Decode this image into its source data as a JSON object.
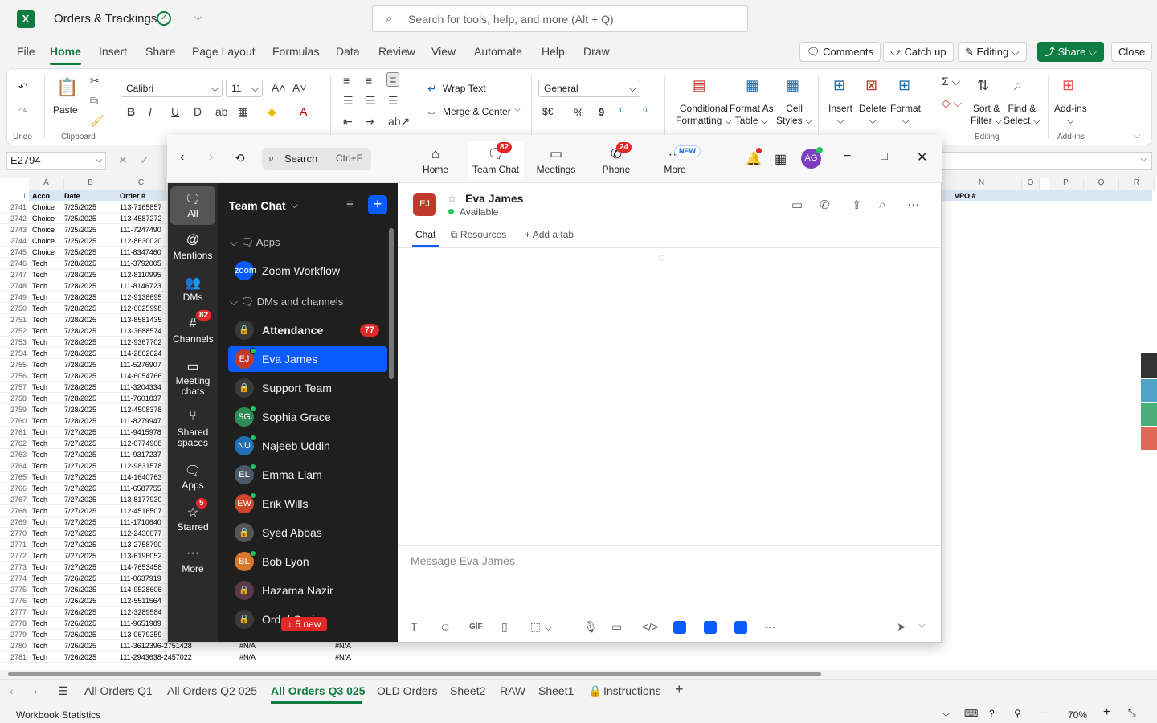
{
  "excel": {
    "doc_name": "Orders & Trackings",
    "search_placeholder": "Search for tools, help, and more (Alt + Q)",
    "menu": [
      "File",
      "Home",
      "Insert",
      "Share",
      "Page Layout",
      "Formulas",
      "Data",
      "Review",
      "View",
      "Automate",
      "Help",
      "Draw"
    ],
    "header_buttons": {
      "comments": "Comments",
      "catch_up": "Catch up",
      "editing": "Editing",
      "share": "Share",
      "close": "Close"
    },
    "ribbon": {
      "undo_group": "Undo",
      "paste": "Paste",
      "clipboard_group": "Clipboard",
      "font_name": "Calibri",
      "font_size": "11",
      "wrap_text": "Wrap Text",
      "merge_center": "Merge & Center",
      "number_format": "General",
      "currency": "$€",
      "percent": "%",
      "comma": "9",
      "conditional_formatting": [
        "Conditional",
        "Formatting"
      ],
      "format_as_table": [
        "Format As",
        "Table"
      ],
      "cell_styles": [
        "Cell",
        "Styles"
      ],
      "insert": "Insert",
      "delete": "Delete",
      "format": "Format",
      "sort_filter": [
        "Sort &",
        "Filter"
      ],
      "find_select": [
        "Find &",
        "Select"
      ],
      "editing_group": "Editing",
      "addins": "Add-ins",
      "addins_group": "Add-ins"
    },
    "name_box": "E2794",
    "columns": {
      "A": "A",
      "B": "B",
      "C": "C",
      "N": "N",
      "O": "O",
      "P": "P",
      "Q": "Q",
      "R": "R"
    },
    "header_row": {
      "num": "1",
      "a": "Acco",
      "b": "Date",
      "c": "Order #",
      "n": "VPO #"
    },
    "rows": [
      [
        "2741",
        "Choice",
        "7/25/2025",
        "113-7165857"
      ],
      [
        "2742",
        "Choice",
        "7/25/2025",
        "113-4587272"
      ],
      [
        "2743",
        "Choice",
        "7/25/2025",
        "111-7247490"
      ],
      [
        "2744",
        "Choice",
        "7/25/2025",
        "112-8630020"
      ],
      [
        "2745",
        "Choice",
        "7/25/2025",
        "111-8347460"
      ],
      [
        "2746",
        "Tech",
        "7/28/2025",
        "111-3792005"
      ],
      [
        "2747",
        "Tech",
        "7/28/2025",
        "112-8110995"
      ],
      [
        "2748",
        "Tech",
        "7/28/2025",
        "111-8146723"
      ],
      [
        "2749",
        "Tech",
        "7/28/2025",
        "112-9138695"
      ],
      [
        "2750",
        "Tech",
        "7/28/2025",
        "112-6025998"
      ],
      [
        "2751",
        "Tech",
        "7/28/2025",
        "113-8581435"
      ],
      [
        "2752",
        "Tech",
        "7/28/2025",
        "113-3688574"
      ],
      [
        "2753",
        "Tech",
        "7/28/2025",
        "112-9367702"
      ],
      [
        "2754",
        "Tech",
        "7/28/2025",
        "114-2862624"
      ],
      [
        "2755",
        "Tech",
        "7/28/2025",
        "111-5276907"
      ],
      [
        "2756",
        "Tech",
        "7/28/2025",
        "114-6054766"
      ],
      [
        "2757",
        "Tech",
        "7/28/2025",
        "111-3204334"
      ],
      [
        "2758",
        "Tech",
        "7/28/2025",
        "111-7601837"
      ],
      [
        "2759",
        "Tech",
        "7/28/2025",
        "112-4508378"
      ],
      [
        "2760",
        "Tech",
        "7/28/2025",
        "111-8279947"
      ],
      [
        "2761",
        "Tech",
        "7/27/2025",
        "111-9415978"
      ],
      [
        "2762",
        "Tech",
        "7/27/2025",
        "112-0774908"
      ],
      [
        "2763",
        "Tech",
        "7/27/2025",
        "111-9317237"
      ],
      [
        "2764",
        "Tech",
        "7/27/2025",
        "112-9831578"
      ],
      [
        "2765",
        "Tech",
        "7/27/2025",
        "114-1640763"
      ],
      [
        "2766",
        "Tech",
        "7/27/2025",
        "111-6587755"
      ],
      [
        "2767",
        "Tech",
        "7/27/2025",
        "113-8177930"
      ],
      [
        "2768",
        "Tech",
        "7/27/2025",
        "112-4516507"
      ],
      [
        "2769",
        "Tech",
        "7/27/2025",
        "111-1710640"
      ],
      [
        "2770",
        "Tech",
        "7/27/2025",
        "112-2436077"
      ],
      [
        "2771",
        "Tech",
        "7/27/2025",
        "113-2758790"
      ],
      [
        "2772",
        "Tech",
        "7/27/2025",
        "113-6196052"
      ],
      [
        "2773",
        "Tech",
        "7/27/2025",
        "114-7653458"
      ],
      [
        "2774",
        "Tech",
        "7/26/2025",
        "111-0637919"
      ],
      [
        "2775",
        "Tech",
        "7/26/2025",
        "114-9528606"
      ],
      [
        "2776",
        "Tech",
        "7/26/2025",
        "112-5511564"
      ],
      [
        "2777",
        "Tech",
        "7/26/2025",
        "112-3289584"
      ],
      [
        "2778",
        "Tech",
        "7/26/2025",
        "111-9651989"
      ],
      [
        "2779",
        "Tech",
        "7/26/2025",
        "113-0679359"
      ],
      [
        "2780",
        "Tech",
        "7/26/2025",
        "111-3612396-2751428",
        "#N/A",
        "#N/A"
      ],
      [
        "2781",
        "Tech",
        "7/26/2025",
        "111-2943638-2457022",
        "#N/A",
        "#N/A"
      ]
    ],
    "sheet_tabs": [
      "All Orders Q1",
      "All Orders Q2 025",
      "All Orders Q3 025",
      "OLD Orders",
      "Sheet2",
      "RAW",
      "Sheet1",
      "Instructions"
    ],
    "status_left": "Workbook Statistics",
    "zoom_level": "70%"
  },
  "zoom": {
    "tabs": [
      {
        "label": "Home",
        "icon": "home-icon"
      },
      {
        "label": "Team Chat",
        "icon": "chat-icon",
        "badge": "82"
      },
      {
        "label": "Meetings",
        "icon": "video-icon"
      },
      {
        "label": "Phone",
        "icon": "phone-icon",
        "badge": "24"
      },
      {
        "label": "More",
        "icon": "more-icon",
        "badge": "NEW"
      }
    ],
    "search": "Search",
    "search_shortcut": "Ctrl+F",
    "avatar": "AG",
    "rail": [
      {
        "label": "All"
      },
      {
        "label": "Mentions"
      },
      {
        "label": "DMs"
      },
      {
        "label": "Channels",
        "badge": "82"
      },
      {
        "label": "Meeting chats"
      },
      {
        "label": "Shared spaces"
      },
      {
        "label": "Apps"
      },
      {
        "label": "Starred",
        "badge": "5"
      },
      {
        "label": "More"
      }
    ],
    "list_title": "Team Chat",
    "section_apps": "Apps",
    "section_dms": "DMs and channels",
    "items": [
      {
        "name": "Zoom Workflow",
        "av": "zoom",
        "color": "#0b5cff"
      },
      {
        "name": "Attendance",
        "av": "",
        "color": "#3a3a3a",
        "badge": "77"
      },
      {
        "name": "Eva James",
        "av": "EJ",
        "color": "#c0392b"
      },
      {
        "name": "Support Team",
        "av": "",
        "color": "#3a3a3a"
      },
      {
        "name": "Sophia Grace",
        "av": "SG",
        "color": "#2e8b57"
      },
      {
        "name": "Najeeb Uddin",
        "av": "NU",
        "color": "#1f6fb2"
      },
      {
        "name": "Emma Liam",
        "av": "EL",
        "color": "#4a5a6a"
      },
      {
        "name": "Erik Wills",
        "av": "EW",
        "color": "#d0452f"
      },
      {
        "name": "Syed Abbas",
        "av": "",
        "color": "#555"
      },
      {
        "name": "Bob Lyon",
        "av": "BL",
        "color": "#d9782a"
      },
      {
        "name": "Hazama Nazir",
        "av": "",
        "color": "#5a3a4a"
      },
      {
        "name": "Ord      d Quries",
        "av": "",
        "color": "#3a3a3a"
      }
    ],
    "new_pill": "↓ 5 new",
    "chat_name": "Eva James",
    "chat_initials": "EJ",
    "chat_status": "Available",
    "chat_tabs": {
      "chat": "Chat",
      "resources": "Resources",
      "add_tab": "Add a tab"
    },
    "composer_placeholder": "Message Eva James"
  }
}
